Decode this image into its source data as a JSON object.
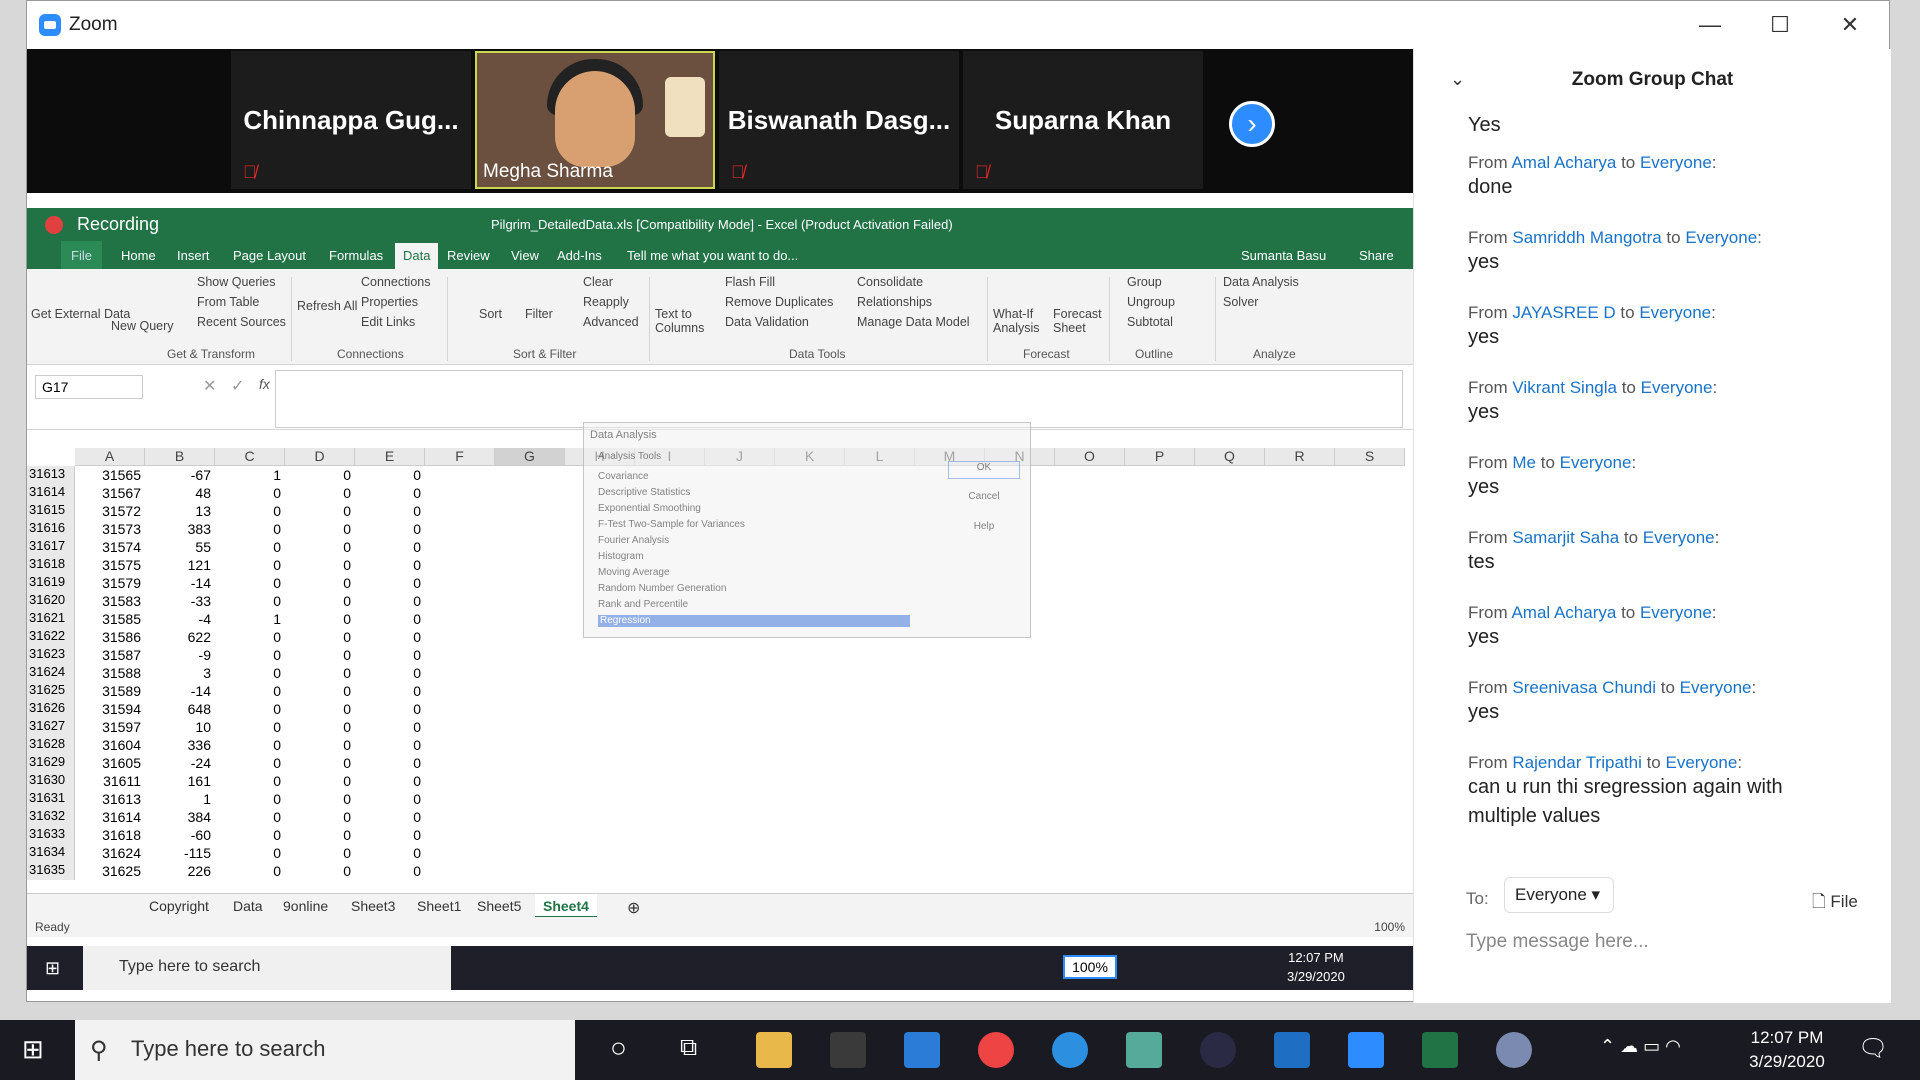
{
  "zoom": {
    "title": "Zoom",
    "participants": [
      {
        "name": "Chinnappa  Gug...",
        "muted": true
      },
      {
        "name": "Megha Sharma",
        "muted": false,
        "video": true
      },
      {
        "name": "Biswanath  Dasg...",
        "muted": true
      },
      {
        "name": "Suparna Khan",
        "muted": true
      }
    ]
  },
  "excel": {
    "recording": "Recording",
    "title": "Pilgrim_DetailedData.xls  [Compatibility Mode] - Excel (Product Activation Failed)",
    "tabs": [
      "File",
      "Home",
      "Insert",
      "Page Layout",
      "Formulas",
      "Data",
      "Review",
      "View",
      "Add-Ins"
    ],
    "tell_me": "Tell me what you want to do...",
    "user": "Sumanta Basu",
    "share": "Share",
    "ribbon": {
      "get_external": "Get External Data",
      "new_query": "New Query",
      "show_queries": "Show Queries",
      "from_table": "From Table",
      "recent_sources": "Recent Sources",
      "get_transform": "Get & Transform",
      "refresh_all": "Refresh All",
      "connections": "Connections",
      "properties": "Properties",
      "edit_links": "Edit Links",
      "connections_grp": "Connections",
      "sort": "Sort",
      "filter": "Filter",
      "clear": "Clear",
      "reapply": "Reapply",
      "advanced": "Advanced",
      "sort_filter": "Sort & Filter",
      "text_to_columns": "Text to Columns",
      "flash_fill": "Flash Fill",
      "remove_duplicates": "Remove Duplicates",
      "data_validation": "Data Validation",
      "consolidate": "Consolidate",
      "relationships": "Relationships",
      "manage_model": "Manage Data Model",
      "data_tools": "Data Tools",
      "what_if": "What-If Analysis",
      "forecast_sheet": "Forecast Sheet",
      "forecast": "Forecast",
      "group": "Group",
      "ungroup": "Ungroup",
      "subtotal": "Subtotal",
      "outline": "Outline",
      "data_analysis": "Data Analysis",
      "solver": "Solver",
      "analyze": "Analyze"
    },
    "name_box": "G17",
    "fx": "fx",
    "columns": [
      "A",
      "B",
      "C",
      "D",
      "E",
      "F",
      "G",
      "H",
      "I",
      "J",
      "K",
      "L",
      "M",
      "N",
      "O",
      "P",
      "Q",
      "R",
      "S"
    ],
    "rows": [
      [
        "31613",
        "31565",
        "-67",
        "1",
        "0",
        "0"
      ],
      [
        "31614",
        "31567",
        "48",
        "0",
        "0",
        "0"
      ],
      [
        "31615",
        "31572",
        "13",
        "0",
        "0",
        "0"
      ],
      [
        "31616",
        "31573",
        "383",
        "0",
        "0",
        "0"
      ],
      [
        "31617",
        "31574",
        "55",
        "0",
        "0",
        "0"
      ],
      [
        "31618",
        "31575",
        "121",
        "0",
        "0",
        "0"
      ],
      [
        "31619",
        "31579",
        "-14",
        "0",
        "0",
        "0"
      ],
      [
        "31620",
        "31583",
        "-33",
        "0",
        "0",
        "0"
      ],
      [
        "31621",
        "31585",
        "-4",
        "1",
        "0",
        "0"
      ],
      [
        "31622",
        "31586",
        "622",
        "0",
        "0",
        "0"
      ],
      [
        "31623",
        "31587",
        "-9",
        "0",
        "0",
        "0"
      ],
      [
        "31624",
        "31588",
        "3",
        "0",
        "0",
        "0"
      ],
      [
        "31625",
        "31589",
        "-14",
        "0",
        "0",
        "0"
      ],
      [
        "31626",
        "31594",
        "648",
        "0",
        "0",
        "0"
      ],
      [
        "31627",
        "31597",
        "10",
        "0",
        "0",
        "0"
      ],
      [
        "31628",
        "31604",
        "336",
        "0",
        "0",
        "0"
      ],
      [
        "31629",
        "31605",
        "-24",
        "0",
        "0",
        "0"
      ],
      [
        "31630",
        "31611",
        "161",
        "0",
        "0",
        "0"
      ],
      [
        "31631",
        "31613",
        "1",
        "0",
        "0",
        "0"
      ],
      [
        "31632",
        "31614",
        "384",
        "0",
        "0",
        "0"
      ],
      [
        "31633",
        "31618",
        "-60",
        "0",
        "0",
        "0"
      ],
      [
        "31634",
        "31624",
        "-115",
        "0",
        "0",
        "0"
      ],
      [
        "31635",
        "31625",
        "226",
        "0",
        "0",
        "0"
      ]
    ],
    "dialog": {
      "title": "Data Analysis",
      "label": "Analysis Tools",
      "items": [
        "Covariance",
        "Descriptive Statistics",
        "Exponential Smoothing",
        "F-Test Two-Sample for Variances",
        "Fourier Analysis",
        "Histogram",
        "Moving Average",
        "Random Number Generation",
        "Rank and Percentile",
        "Regression"
      ],
      "ok": "OK",
      "cancel": "Cancel",
      "help": "Help"
    },
    "sheets": [
      "Copyright",
      "Data",
      "9online",
      "Sheet3",
      "Sheet1",
      "Sheet5",
      "Sheet4"
    ],
    "active_sheet": "Sheet4",
    "status": "Ready",
    "zoom_pct": "100%"
  },
  "inner_taskbar": {
    "search": "Type here to search",
    "time": "12:07 PM",
    "date": "3/29/2020",
    "zoom": "100%"
  },
  "chat": {
    "title": "Zoom Group Chat",
    "first": "Yes",
    "messages": [
      {
        "from": "Amal Acharya",
        "to": "Everyone",
        "text": "done"
      },
      {
        "from": "Samriddh Mangotra",
        "to": "Everyone",
        "text": "yes"
      },
      {
        "from": "JAYASREE D",
        "to": "Everyone",
        "text": "yes"
      },
      {
        "from": "Vikrant Singla",
        "to": "Everyone",
        "text": "yes"
      },
      {
        "from": "Me",
        "to": "Everyone",
        "text": "yes"
      },
      {
        "from": "Samarjit Saha",
        "to": "Everyone",
        "text": "tes"
      },
      {
        "from": "Amal Acharya",
        "to": "Everyone",
        "text": "yes"
      },
      {
        "from": "Sreenivasa Chundi",
        "to": "Everyone",
        "text": "yes"
      },
      {
        "from": "Rajendar Tripathi",
        "to": "Everyone",
        "text": "can u run thi sregression again with multiple values"
      }
    ],
    "to_label": "To:",
    "recipient": "Everyone",
    "file": "File",
    "placeholder": "Type message here..."
  },
  "taskbar": {
    "search": "Type here to search",
    "time": "12:07 PM",
    "date": "3/29/2020"
  },
  "colors": {
    "excel_green": "#217346",
    "zoom_blue": "#2d8cff",
    "chat_link": "#1a73c8"
  }
}
